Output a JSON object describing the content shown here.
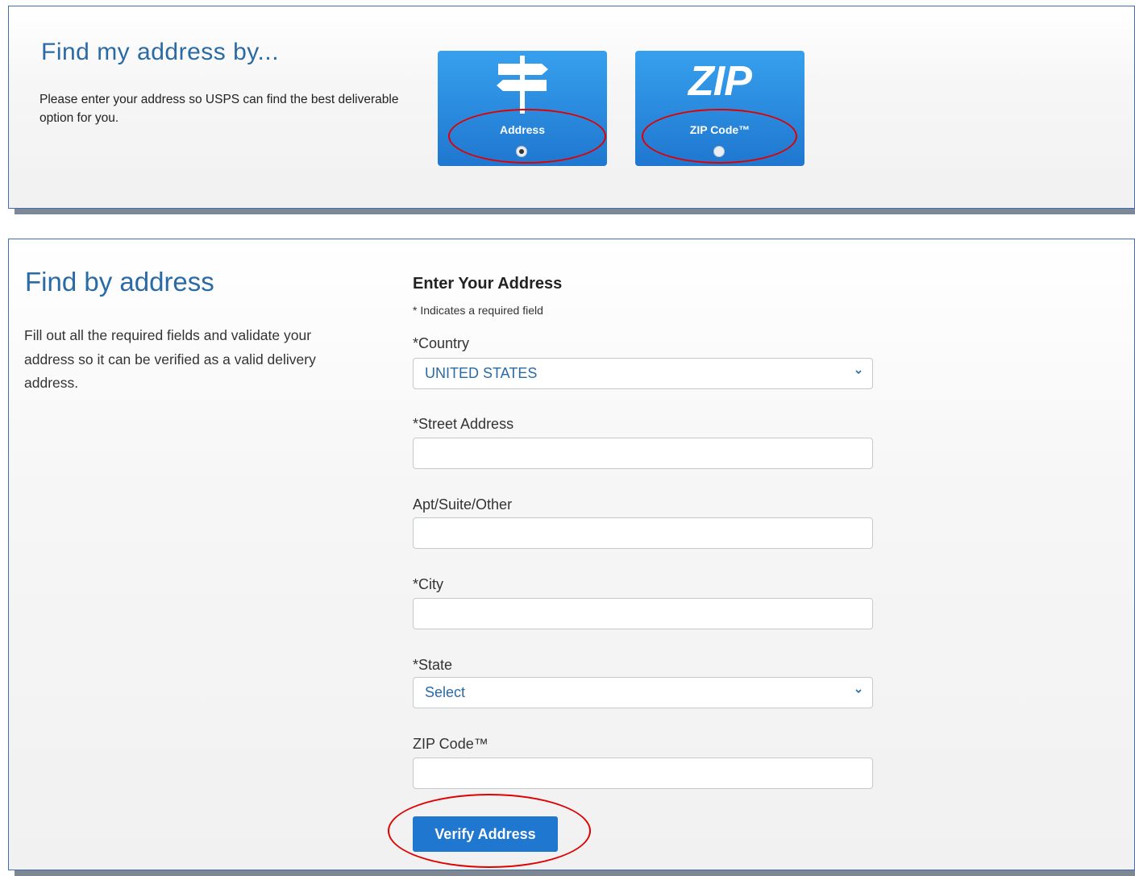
{
  "find_by": {
    "title": "Find my address by...",
    "description": "Please enter your address so USPS can find the best deliverable option for you.",
    "options": [
      {
        "label": "Address",
        "icon": "signpost-icon",
        "selected": true
      },
      {
        "label": "ZIP Code™",
        "logo_text": "ZIP",
        "selected": false
      }
    ]
  },
  "main": {
    "title": "Find by address",
    "description": "Fill out all the required fields and validate your address so it can be verified as a valid delivery address."
  },
  "form": {
    "title": "Enter Your Address",
    "required_note": "* Indicates a required field",
    "country": {
      "label": "*Country",
      "value": "UNITED STATES"
    },
    "street": {
      "label": "*Street Address",
      "value": ""
    },
    "apt": {
      "label": "Apt/Suite/Other",
      "value": ""
    },
    "city": {
      "label": "*City",
      "value": ""
    },
    "state": {
      "label": "*State",
      "value": "Select"
    },
    "zip": {
      "label": "ZIP Code™",
      "value": ""
    },
    "verify_label": "Verify Address"
  },
  "colors": {
    "accent": "#1f77cf",
    "title": "#2a6aa5",
    "highlight_oval": "#e00000"
  }
}
